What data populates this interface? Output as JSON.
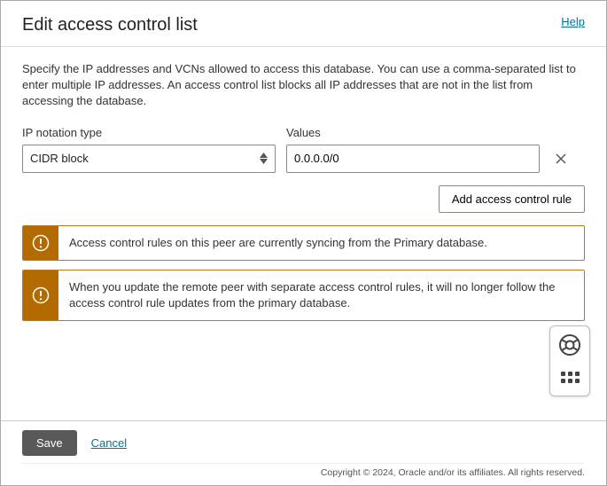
{
  "header": {
    "title": "Edit access control list",
    "help": "Help"
  },
  "description": "Specify the IP addresses and VCNs allowed to access this database. You can use a comma-separated list to enter multiple IP addresses. An access control list blocks all IP addresses that are not in the list from accessing the database.",
  "fields": {
    "ip_notation_label": "IP notation type",
    "ip_notation_value": "CIDR block",
    "values_label": "Values",
    "values_value": "0.0.0.0/0"
  },
  "buttons": {
    "add_rule": "Add access control rule",
    "save": "Save",
    "cancel": "Cancel"
  },
  "alerts": [
    "Access control rules on this peer are currently syncing from the Primary database.",
    "When you update the remote peer with separate access control rules, it will no longer follow the access control rule updates from the primary database."
  ],
  "footer": {
    "copyright": "Copyright © 2024, Oracle and/or its affiliates. All rights reserved."
  }
}
